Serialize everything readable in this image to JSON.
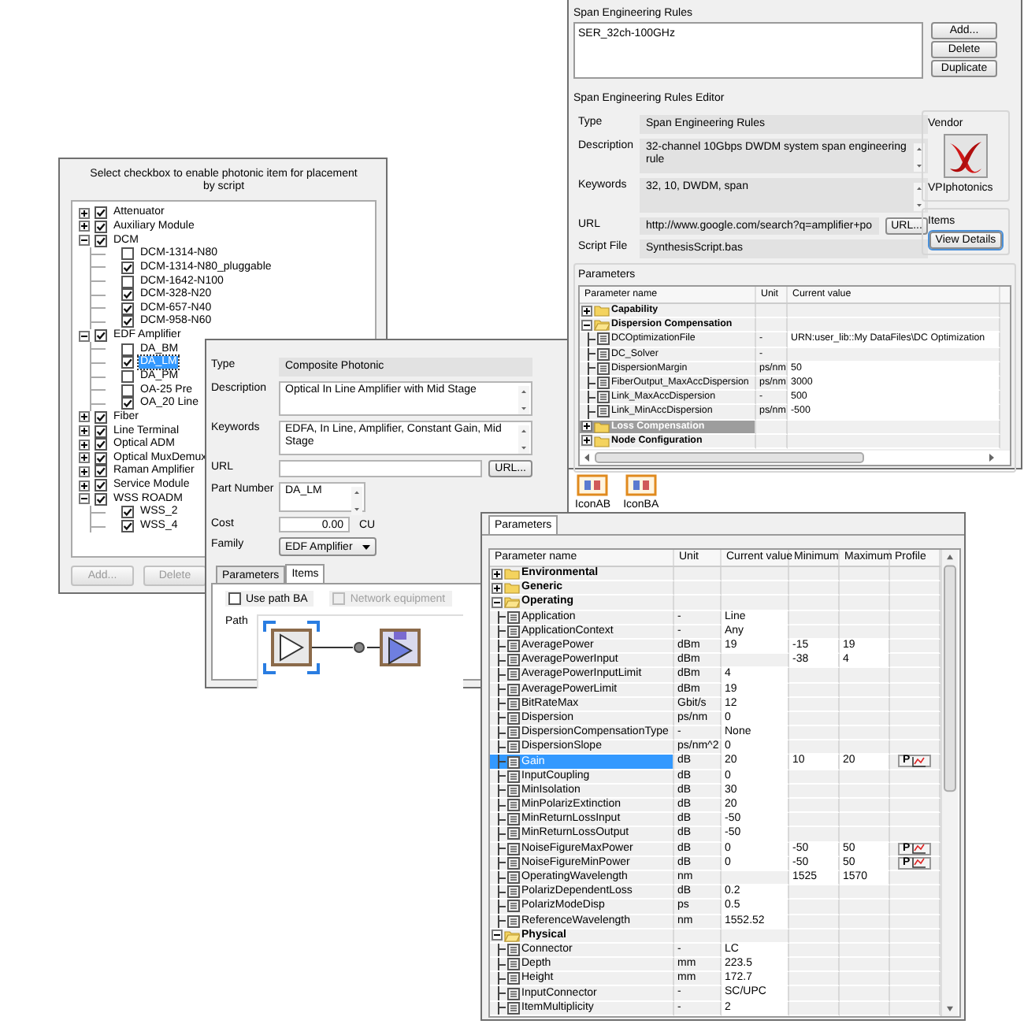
{
  "rules_window": {
    "rules_title": "Span Engineering Rules",
    "rules": [
      {
        "name": "SER_32ch-100GHz"
      }
    ],
    "buttons": [
      "Add...",
      "Delete",
      "Duplicate"
    ],
    "editor_title": "Span Engineering Rules Editor",
    "fields": [
      {
        "label": "Type",
        "value": "Span Engineering Rules",
        "kind": "text",
        "readonly": true
      },
      {
        "label": "Description",
        "value": "32-channel 10Gbps DWDM system span engineering rule",
        "kind": "multiline",
        "readonly": true
      },
      {
        "label": "Keywords",
        "value": "32, 10, DWDM, span",
        "kind": "multiline",
        "readonly": true
      },
      {
        "label": "URL",
        "value": "http://www.google.com/search?q=amplifier+po",
        "kind": "url",
        "button": "URL...",
        "readonly": true
      },
      {
        "label": "Script File",
        "value": "SynthesisScript.bas",
        "kind": "text",
        "readonly": true
      }
    ],
    "vendor": {
      "title": "Vendor",
      "name": "VPIphotonics"
    },
    "items": {
      "title": "Items",
      "button": "View Details"
    },
    "parameters": {
      "title": "Parameters",
      "columns": [
        "Parameter name",
        "Unit",
        "Current value"
      ],
      "rows": [
        {
          "kind": "group",
          "name": "Capability",
          "expanded": false,
          "selected": false
        },
        {
          "kind": "group",
          "name": "Dispersion Compensation",
          "expanded": true,
          "selected": false,
          "children": [
            {
              "kind": "param",
              "name": "DCOptimizationFile",
              "unit": "-",
              "value": "URN:user_lib::My DataFiles\\DC Optimization",
              "selected": false
            },
            {
              "kind": "param",
              "name": "DC_Solver",
              "unit": "-",
              "selected": false
            },
            {
              "kind": "param",
              "name": "DispersionMargin",
              "unit": "ps/nm",
              "value": "50",
              "selected": false
            },
            {
              "kind": "param",
              "name": "FiberOutput_MaxAccDispersion",
              "unit": "ps/nm",
              "value": "3000",
              "selected": false
            },
            {
              "kind": "param",
              "name": "Link_MaxAccDispersion",
              "unit": "-",
              "value": "500",
              "selected": false
            },
            {
              "kind": "param",
              "name": "Link_MinAccDispersion",
              "unit": "ps/nm",
              "value": "-500",
              "selected": false
            }
          ]
        },
        {
          "kind": "group",
          "name": "Loss Compensation",
          "expanded": false,
          "selected": true
        },
        {
          "kind": "group",
          "name": "Node Configuration",
          "expanded": false,
          "selected": false
        }
      ]
    }
  },
  "palette": [
    {
      "label": "IconAB"
    },
    {
      "label": "IconBA"
    }
  ],
  "checkbox_window": {
    "instruction": "Select checkbox to enable photonic item for placement by script",
    "tree": [
      {
        "label": "Attenuator",
        "checked": true,
        "expanded": false,
        "selected": false
      },
      {
        "label": "Auxiliary Module",
        "checked": true,
        "expanded": false,
        "selected": false
      },
      {
        "label": "DCM",
        "checked": true,
        "expanded": true,
        "selected": false,
        "children": [
          {
            "label": "DCM-1314-N80",
            "checked": false,
            "selected": false
          },
          {
            "label": "DCM-1314-N80_pluggable",
            "checked": true,
            "selected": false
          },
          {
            "label": "DCM-1642-N100",
            "checked": false,
            "selected": false
          },
          {
            "label": "DCM-328-N20",
            "checked": true,
            "selected": false
          },
          {
            "label": "DCM-657-N40",
            "checked": true,
            "selected": false
          },
          {
            "label": "DCM-958-N60",
            "checked": true,
            "selected": false
          }
        ]
      },
      {
        "label": "EDF Amplifier",
        "checked": true,
        "expanded": true,
        "selected": false,
        "children": [
          {
            "label": "DA_BM",
            "checked": false,
            "selected": false
          },
          {
            "label": "DA_LM",
            "checked": true,
            "selected": true
          },
          {
            "label": "DA_PM",
            "checked": false,
            "selected": false
          },
          {
            "label": "OA-25 Pre",
            "checked": false,
            "selected": false
          },
          {
            "label": "OA_20 Line",
            "checked": true,
            "selected": false
          }
        ]
      },
      {
        "label": "Fiber",
        "checked": true,
        "expanded": false,
        "selected": false
      },
      {
        "label": "Line Terminal",
        "checked": true,
        "expanded": false,
        "selected": false
      },
      {
        "label": "Optical ADM",
        "checked": true,
        "expanded": false,
        "selected": false
      },
      {
        "label": "Optical MuxDemux",
        "checked": true,
        "expanded": false,
        "selected": false
      },
      {
        "label": "Raman Amplifier",
        "checked": true,
        "expanded": false,
        "selected": false
      },
      {
        "label": "Service Module",
        "checked": true,
        "expanded": false,
        "selected": false
      },
      {
        "label": "WSS ROADM",
        "checked": true,
        "expanded": true,
        "selected": false,
        "children": [
          {
            "label": "WSS_2",
            "checked": true,
            "selected": false
          },
          {
            "label": "WSS_4",
            "checked": true,
            "selected": false
          }
        ]
      }
    ],
    "buttons": [
      {
        "label": "Add...",
        "disabled": true
      },
      {
        "label": "Delete",
        "disabled": true
      }
    ]
  },
  "component_window": {
    "fields": [
      {
        "label": "Type",
        "value": "Composite Photonic",
        "kind": "text",
        "readonly": true
      },
      {
        "label": "Description",
        "value": "Optical In Line Amplifier with Mid Stage",
        "kind": "multiline",
        "readonly": false
      },
      {
        "label": "Keywords",
        "value": "EDFA, In Line, Amplifier, Constant Gain, Mid Stage",
        "kind": "multiline",
        "readonly": false
      },
      {
        "label": "URL",
        "kind": "url",
        "button": "URL...",
        "readonly": false
      },
      {
        "label": "Part Number",
        "value": "DA_LM",
        "kind": "short",
        "readonly": false
      },
      {
        "label": "Cost",
        "value": "0.00",
        "kind": "number",
        "unit": "CU",
        "readonly": false
      },
      {
        "label": "Family",
        "value": "EDF Amplifier",
        "kind": "dropdown"
      }
    ],
    "tabs": [
      {
        "label": "Parameters",
        "selected": false
      },
      {
        "label": "Items",
        "selected": true
      }
    ],
    "options": [
      {
        "label": "Use path BA",
        "checked": false,
        "disabled": false
      },
      {
        "label": "Network equipment",
        "checked": false,
        "disabled": true
      }
    ],
    "path_label": "Path"
  },
  "parameters_window": {
    "tab": "Parameters",
    "columns": [
      "Parameter name",
      "Unit",
      "Current value",
      "Minimum",
      "Maximum",
      "Profile"
    ],
    "rows": [
      {
        "kind": "group",
        "name": "Environmental",
        "expanded": false,
        "selected": false
      },
      {
        "kind": "group",
        "name": "Generic",
        "expanded": false,
        "selected": false
      },
      {
        "kind": "group",
        "name": "Operating",
        "expanded": true,
        "selected": false,
        "children": [
          {
            "kind": "param",
            "name": "Application",
            "unit": "-",
            "value": "Line",
            "selected": false
          },
          {
            "kind": "param",
            "name": "ApplicationContext",
            "unit": "-",
            "value": "Any",
            "selected": false
          },
          {
            "kind": "param",
            "name": "AveragePower",
            "unit": "dBm",
            "value": "19",
            "minimum": "-15",
            "maximum": "19",
            "selected": false
          },
          {
            "kind": "param",
            "name": "AveragePowerInput",
            "unit": "dBm",
            "minimum": "-38",
            "maximum": "4",
            "selected": false
          },
          {
            "kind": "param",
            "name": "AveragePowerInputLimit",
            "unit": "dBm",
            "value": "4",
            "selected": false
          },
          {
            "kind": "param",
            "name": "AveragePowerLimit",
            "unit": "dBm",
            "value": "19",
            "selected": false
          },
          {
            "kind": "param",
            "name": "BitRateMax",
            "unit": "Gbit/s",
            "value": "12",
            "selected": false
          },
          {
            "kind": "param",
            "name": "Dispersion",
            "unit": "ps/nm",
            "value": "0",
            "selected": false
          },
          {
            "kind": "param",
            "name": "DispersionCompensationType",
            "unit": "-",
            "value": "None",
            "selected": false
          },
          {
            "kind": "param",
            "name": "DispersionSlope",
            "unit": "ps/nm^2",
            "value": "0",
            "selected": false
          },
          {
            "kind": "param",
            "name": "Gain",
            "unit": "dB",
            "value": "20",
            "minimum": "10",
            "maximum": "20",
            "profile": "P",
            "selected": true
          },
          {
            "kind": "param",
            "name": "InputCoupling",
            "unit": "dB",
            "value": "0",
            "selected": false
          },
          {
            "kind": "param",
            "name": "MinIsolation",
            "unit": "dB",
            "value": "30",
            "selected": false
          },
          {
            "kind": "param",
            "name": "MinPolarizExtinction",
            "unit": "dB",
            "value": "20",
            "selected": false
          },
          {
            "kind": "param",
            "name": "MinReturnLossInput",
            "unit": "dB",
            "value": "-50",
            "selected": false
          },
          {
            "kind": "param",
            "name": "MinReturnLossOutput",
            "unit": "dB",
            "value": "-50",
            "selected": false
          },
          {
            "kind": "param",
            "name": "NoiseFigureMaxPower",
            "unit": "dB",
            "value": "0",
            "minimum": "-50",
            "maximum": "50",
            "profile": "P",
            "selected": false
          },
          {
            "kind": "param",
            "name": "NoiseFigureMinPower",
            "unit": "dB",
            "value": "0",
            "minimum": "-50",
            "maximum": "50",
            "profile": "P",
            "selected": false
          },
          {
            "kind": "param",
            "name": "OperatingWavelength",
            "unit": "nm",
            "minimum": "1525",
            "maximum": "1570",
            "selected": false
          },
          {
            "kind": "param",
            "name": "PolarizDependentLoss",
            "unit": "dB",
            "value": "0.2",
            "selected": false
          },
          {
            "kind": "param",
            "name": "PolarizModeDisp",
            "unit": "ps",
            "value": "0.5",
            "selected": false
          },
          {
            "kind": "param",
            "name": "ReferenceWavelength",
            "unit": "nm",
            "value": "1552.52",
            "selected": false
          }
        ]
      },
      {
        "kind": "group",
        "name": "Physical",
        "expanded": true,
        "selected": false,
        "children": [
          {
            "kind": "param",
            "name": "Connector",
            "unit": "-",
            "value": "LC",
            "selected": false
          },
          {
            "kind": "param",
            "name": "Depth",
            "unit": "mm",
            "value": "223.5",
            "selected": false
          },
          {
            "kind": "param",
            "name": "Height",
            "unit": "mm",
            "value": "172.7",
            "selected": false
          },
          {
            "kind": "param",
            "name": "InputConnector",
            "unit": "-",
            "value": "SC/UPC",
            "selected": false
          },
          {
            "kind": "param",
            "name": "ItemMultiplicity",
            "unit": "-",
            "value": "2",
            "selected": false
          }
        ]
      }
    ]
  }
}
